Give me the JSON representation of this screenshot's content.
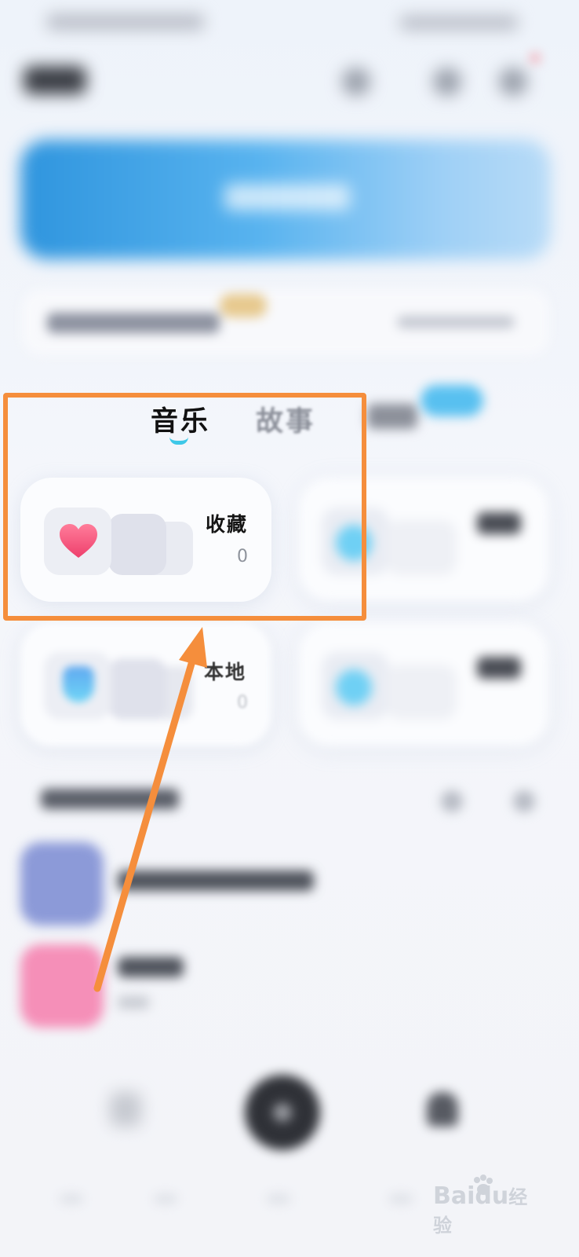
{
  "tabs": {
    "music": "音乐",
    "story": "故事"
  },
  "cards": {
    "favorites": {
      "title": "收藏",
      "count": "0"
    },
    "local": {
      "title": "本地",
      "count": "0"
    }
  },
  "watermark": {
    "brand": "Baidu",
    "suffix": "经验"
  },
  "colors": {
    "accent": "#3ec8e8",
    "annotation": "#f58e3c",
    "heart": "#f2567c",
    "banner": "#4aa8ea"
  },
  "icons": {
    "favorites": "heart-icon",
    "local": "download-icon"
  }
}
